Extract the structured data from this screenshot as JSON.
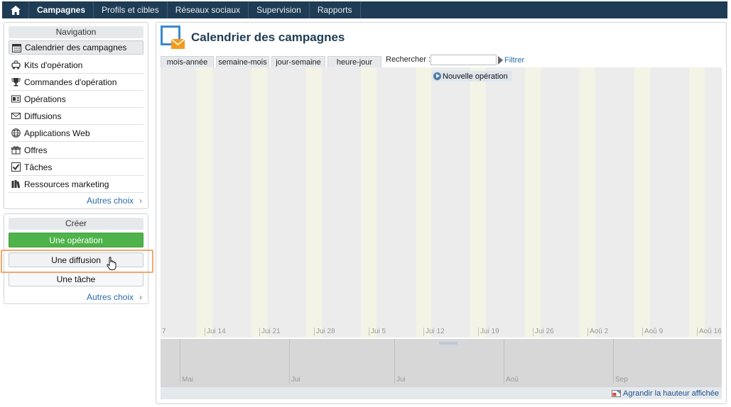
{
  "topnav": {
    "home_icon": "home-icon",
    "tabs": [
      {
        "label": "Campagnes",
        "active": true
      },
      {
        "label": "Profils et cibles",
        "active": false
      },
      {
        "label": "Réseaux sociaux",
        "active": false
      },
      {
        "label": "Supervision",
        "active": false
      },
      {
        "label": "Rapports",
        "active": false
      }
    ]
  },
  "sidebar": {
    "navigation": {
      "title": "Navigation",
      "items": [
        {
          "label": "Calendrier des campagnes",
          "icon": "calendar-icon",
          "selected": true
        },
        {
          "label": "Kits d'opération",
          "icon": "kit-icon"
        },
        {
          "label": "Commandes d'opération",
          "icon": "trophy-icon"
        },
        {
          "label": "Opérations",
          "icon": "operations-icon"
        },
        {
          "label": "Diffusions",
          "icon": "envelope-icon"
        },
        {
          "label": "Applications Web",
          "icon": "globe-icon"
        },
        {
          "label": "Offres",
          "icon": "gift-icon"
        },
        {
          "label": "Tâches",
          "icon": "checkbox-icon"
        },
        {
          "label": "Ressources marketing",
          "icon": "books-icon"
        }
      ],
      "more": "Autres choix"
    },
    "create": {
      "title": "Créer",
      "buttons": {
        "operation": "Une opération",
        "delivery": "Une diffusion",
        "task": "Une tâche"
      },
      "more": "Autres choix"
    }
  },
  "main": {
    "title": "Calendrier des campagnes",
    "view_tabs": [
      "mois-année",
      "semaine-mois",
      "jour-semaine",
      "heure-jour"
    ],
    "search": {
      "label": "Rechercher :",
      "value": "",
      "placeholder": ""
    },
    "filter_label": "Filtrer",
    "new_operation": "Nouvelle opération",
    "timeline_dates": [
      "7",
      "Jui 14",
      "Jui 21",
      "Jui 28",
      "Jui 5",
      "Jui 12",
      "Jui 19",
      "Jui 26",
      "Aoû 2",
      "Aoû 9",
      "Aoû 16"
    ],
    "overview_months": [
      "Mai",
      "Jui",
      "Jui",
      "Aoû",
      "Sep"
    ],
    "enlarge_label": "Agrandir la hauteur affichée"
  },
  "colors": {
    "nav_bg": "#1f3c55",
    "accent_green": "#4db34a",
    "highlight_orange": "#f0a86a",
    "link_blue": "#2c6aa8"
  }
}
